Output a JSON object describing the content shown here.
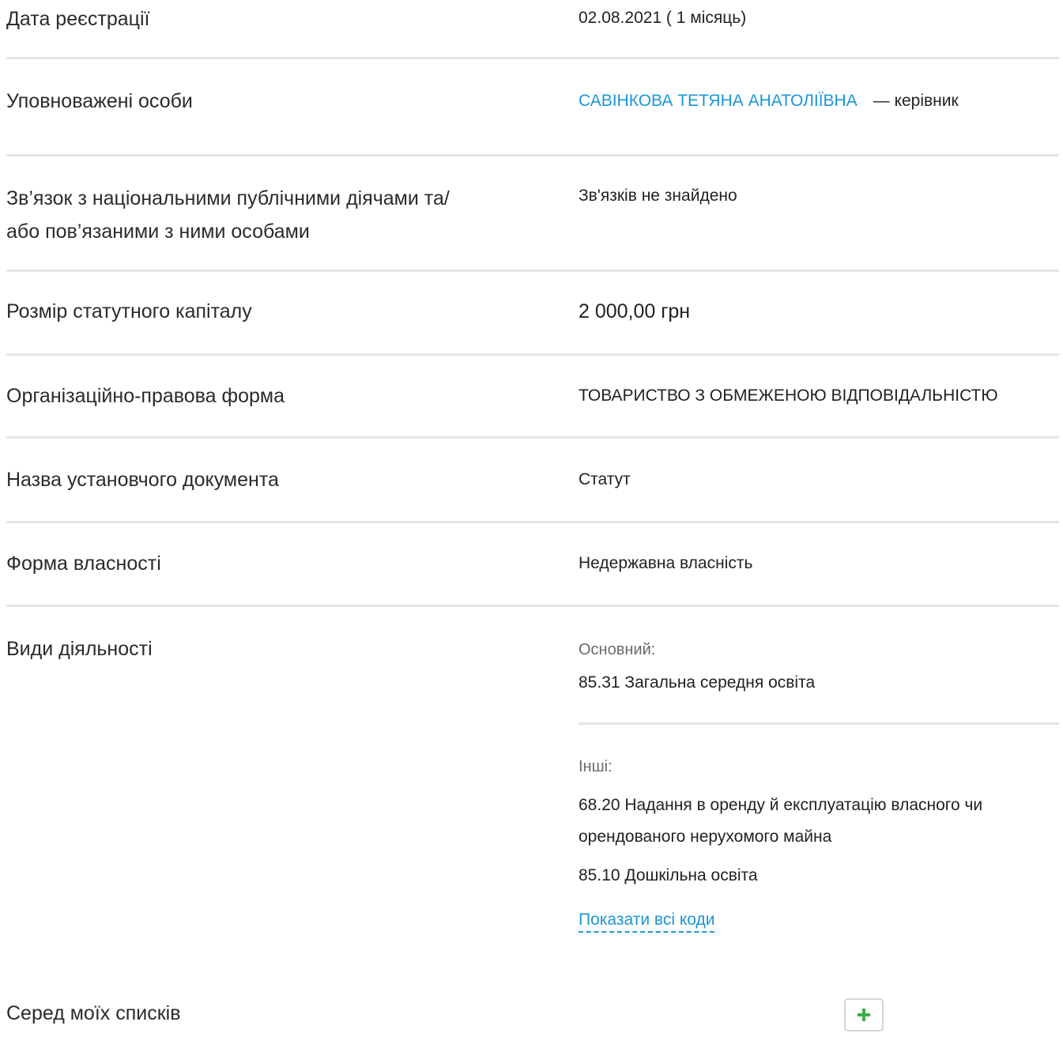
{
  "rows": {
    "registration_date": {
      "label": "Дата реєстрації",
      "value": "02.08.2021 ( 1 місяць)"
    },
    "authorized_persons": {
      "label": "Уповноважені особи",
      "person_name": "САВІНКОВА ТЕТЯНА АНАТОЛІЇВНА",
      "role": "— керівник"
    },
    "pep_links": {
      "label_line1": "Зв’язок з національними публічними діячами та/",
      "label_line2": "або пов’язаними з ними особами",
      "value": "Зв'язків не знайдено"
    },
    "capital": {
      "label": "Розмір статутного капіталу",
      "value": "2 000,00 грн"
    },
    "legal_form": {
      "label": "Організаційно-правова форма",
      "value": "ТОВАРИСТВО З ОБМЕЖЕНОЮ ВІДПОВІДАЛЬНІСТЮ"
    },
    "founding_document": {
      "label": "Назва установчого документа",
      "value": "Статут"
    },
    "ownership": {
      "label": "Форма власності",
      "value": "Недержавна власність"
    },
    "activities": {
      "label": "Види діяльності",
      "main_heading": "Основний:",
      "main_item": "85.31 Загальна середня освіта",
      "other_heading": "Інші:",
      "other_item1_line1": "68.20 Надання в оренду й експлуатацію власного чи",
      "other_item1_line2": "орендованого нерухомого майна",
      "other_item2": "85.10 Дошкільна освіта",
      "show_all_link": "Показати всі коди"
    }
  },
  "lists": {
    "label": "Серед моїх списків",
    "add_button_icon": "plus-icon"
  },
  "colors": {
    "link": "#1c96d4",
    "plus": "#3fae49",
    "divider": "#e6e6e6"
  }
}
